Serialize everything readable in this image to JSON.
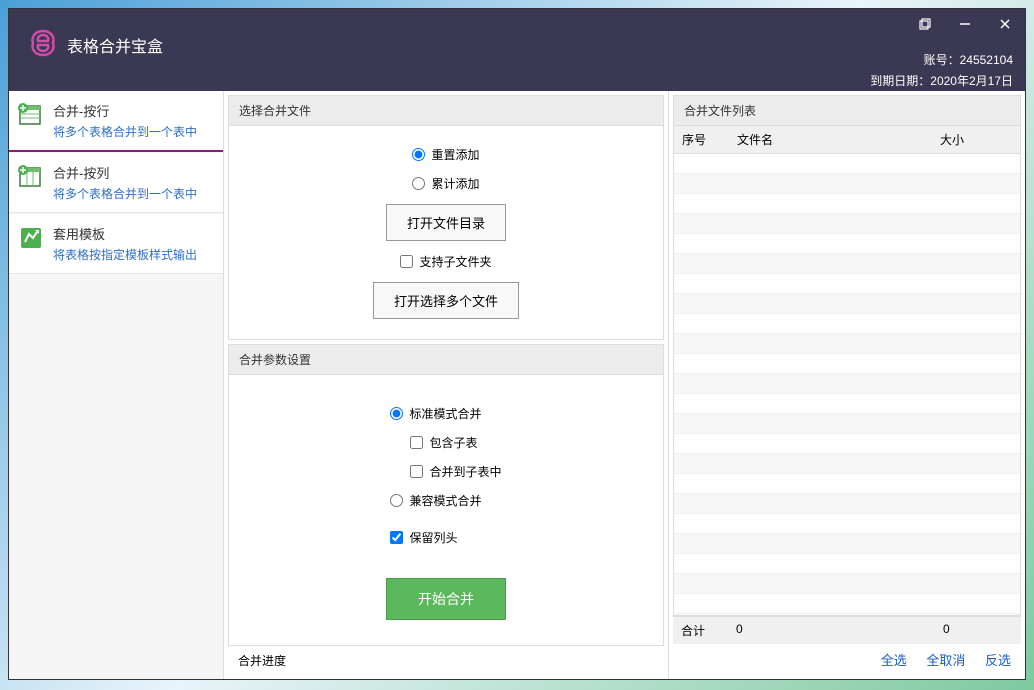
{
  "header": {
    "app_title": "表格合并宝盒",
    "account_label": "账号：",
    "account_number": "24552104",
    "expiry_label": "到期日期：",
    "expiry_date": "2020年2月17日"
  },
  "sidebar": {
    "items": [
      {
        "title": "合并-按行",
        "desc": "将多个表格合并到一个表中"
      },
      {
        "title": "合并-按列",
        "desc": "将多个表格合并到一个表中"
      },
      {
        "title": "套用模板",
        "desc": "将表格按指定模板样式输出"
      }
    ]
  },
  "file_select": {
    "header": "选择合并文件",
    "radio_reset": "重置添加",
    "radio_append": "累计添加",
    "btn_open_dir": "打开文件目录",
    "check_subdir": "支持子文件夹",
    "btn_open_multi": "打开选择多个文件"
  },
  "params": {
    "header": "合并参数设置",
    "radio_standard": "标准模式合并",
    "check_include_sub": "包含子表",
    "check_merge_to_sub": "合并到子表中",
    "radio_compat": "兼容模式合并",
    "check_keep_header": "保留列头",
    "btn_start": "开始合并"
  },
  "progress": {
    "label": "合并进度"
  },
  "file_list": {
    "header": "合并文件列表",
    "col_seq": "序号",
    "col_name": "文件名",
    "col_size": "大小",
    "footer_label": "合计",
    "footer_count": "0",
    "footer_size": "0",
    "select_all": "全选",
    "deselect_all": "全取消",
    "invert": "反选"
  }
}
